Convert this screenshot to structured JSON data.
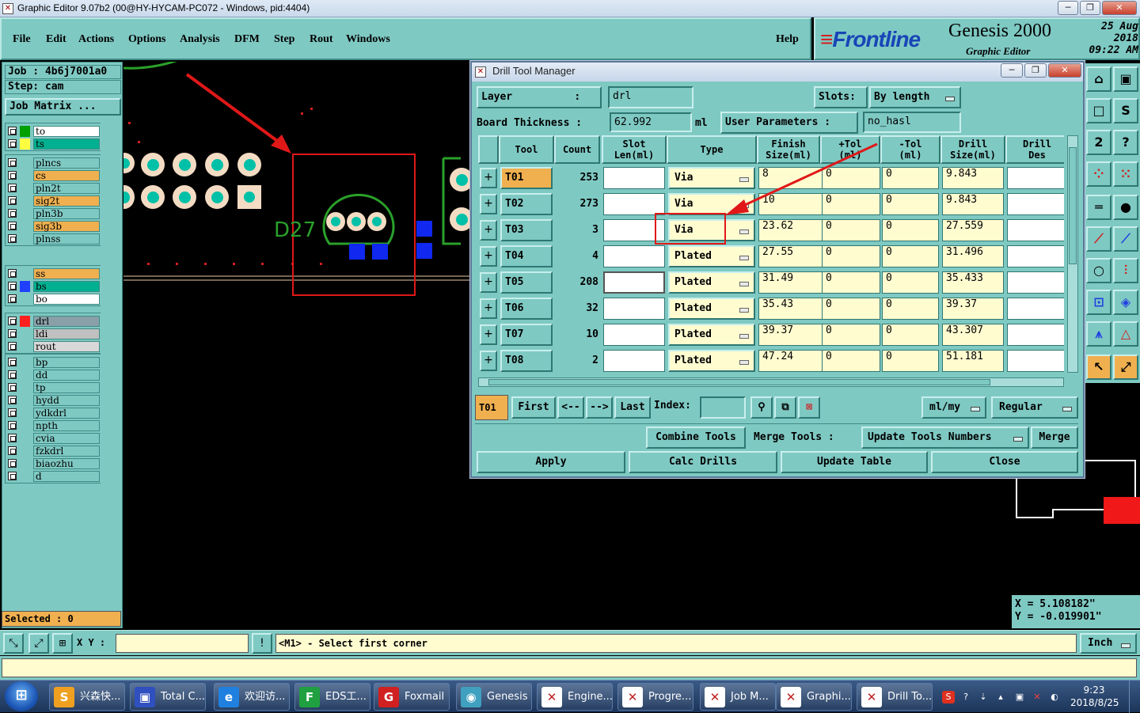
{
  "window": {
    "title": "Graphic Editor 9.07b2 (00@HY-HYCAM-PC072 - Windows, pid:4404)"
  },
  "menu": [
    "File",
    "Edit",
    "Actions",
    "Options",
    "Analysis",
    "DFM",
    "Step",
    "Rout",
    "Windows"
  ],
  "help": "Help",
  "brand": {
    "logo": "Frontline",
    "product": "Genesis 2000",
    "subtitle": "Graphic Editor",
    "date": "25 Aug 2018",
    "time": "09:22 AM"
  },
  "job": {
    "job_label": "Job : 4b6j7001a0",
    "step_label": "Step: cam",
    "matrix_button": "Job Matrix ..."
  },
  "layer_groups": [
    [
      {
        "name": "to",
        "swatch": "#00a000",
        "bg": "#ffffff"
      },
      {
        "name": "ts",
        "swatch": "#ffff40",
        "bg": "#00b090"
      }
    ],
    [
      {
        "name": "plncs",
        "swatch": "",
        "bg": "#7fc9c3"
      },
      {
        "name": "cs",
        "swatch": "",
        "bg": "#f0b050"
      },
      {
        "name": "pln2t",
        "swatch": "",
        "bg": "#7fc9c3"
      },
      {
        "name": "sig2t",
        "swatch": "",
        "bg": "#f0b050"
      },
      {
        "name": "pln3b",
        "swatch": "",
        "bg": "#7fc9c3"
      },
      {
        "name": "sig3b",
        "swatch": "",
        "bg": "#f0b050"
      },
      {
        "name": "plnss",
        "swatch": "",
        "bg": "#7fc9c3"
      }
    ],
    [
      {
        "name": "ss",
        "swatch": "",
        "bg": "#f0b050"
      },
      {
        "name": "bs",
        "swatch": "#2040ff",
        "bg": "#00b090"
      },
      {
        "name": "bo",
        "swatch": "",
        "bg": "#ffffff"
      }
    ],
    [
      {
        "name": "drl",
        "swatch": "#ff2020",
        "bg": "#8aa0a8"
      },
      {
        "name": "ldi",
        "swatch": "",
        "bg": "#c0c0c0"
      },
      {
        "name": "rout",
        "swatch": "",
        "bg": "#d8d8d8"
      }
    ],
    [
      {
        "name": "bp",
        "swatch": "",
        "bg": "#7fc9c3"
      },
      {
        "name": "dd",
        "swatch": "",
        "bg": "#7fc9c3"
      },
      {
        "name": "tp",
        "swatch": "",
        "bg": "#7fc9c3"
      },
      {
        "name": "hydd",
        "swatch": "",
        "bg": "#7fc9c3"
      },
      {
        "name": "ydkdrl",
        "swatch": "",
        "bg": "#7fc9c3"
      },
      {
        "name": "npth",
        "swatch": "",
        "bg": "#7fc9c3"
      },
      {
        "name": "cvia",
        "swatch": "",
        "bg": "#7fc9c3"
      },
      {
        "name": "fzkdrl",
        "swatch": "",
        "bg": "#7fc9c3"
      },
      {
        "name": "biaozhu",
        "swatch": "",
        "bg": "#7fc9c3"
      },
      {
        "name": "d",
        "swatch": "",
        "bg": "#7fc9c3"
      }
    ]
  ],
  "selected": "Selected : 0",
  "canvas": {
    "component_label": "D27"
  },
  "dialog": {
    "title": "Drill Tool Manager",
    "layer_label": "Layer          :",
    "layer_value": "drl",
    "slots_label": "Slots:",
    "slots_value": "By length",
    "thickness_label": "Board Thickness :",
    "thickness_value": "62.992",
    "thickness_unit": "ml",
    "user_params_label": "User Parameters :",
    "user_params_value": "no_hasl",
    "headers": [
      "Tool",
      "Count",
      "Slot\nLen(ml)",
      "Type",
      "Finish\nSize(ml)",
      "+Tol\n(ml)",
      "-Tol\n(ml)",
      "Drill\nSize(ml)",
      "Drill\nDes"
    ],
    "rows": [
      {
        "tool": "T01",
        "count": "253",
        "type": "Via",
        "finish": "8",
        "ptol": "0",
        "mtol": "0",
        "drill": "9.843"
      },
      {
        "tool": "T02",
        "count": "273",
        "type": "Via",
        "finish": "10",
        "ptol": "0",
        "mtol": "0",
        "drill": "9.843"
      },
      {
        "tool": "T03",
        "count": "3",
        "type": "Via",
        "finish": "23.62",
        "ptol": "0",
        "mtol": "0",
        "drill": "27.559"
      },
      {
        "tool": "T04",
        "count": "4",
        "type": "Plated",
        "finish": "27.55",
        "ptol": "0",
        "mtol": "0",
        "drill": "31.496"
      },
      {
        "tool": "T05",
        "count": "208",
        "type": "Plated",
        "finish": "31.49",
        "ptol": "0",
        "mtol": "0",
        "drill": "35.433"
      },
      {
        "tool": "T06",
        "count": "32",
        "type": "Plated",
        "finish": "35.43",
        "ptol": "0",
        "mtol": "0",
        "drill": "39.37"
      },
      {
        "tool": "T07",
        "count": "10",
        "type": "Plated",
        "finish": "39.37",
        "ptol": "0",
        "mtol": "0",
        "drill": "43.307"
      },
      {
        "tool": "T08",
        "count": "2",
        "type": "Plated",
        "finish": "47.24",
        "ptol": "0",
        "mtol": "0",
        "drill": "51.181"
      }
    ],
    "current_tool": "T01",
    "nav": {
      "first": "First",
      "prev": "<--",
      "next": "-->",
      "last": "Last",
      "index_label": "Index:"
    },
    "units": "ml/my",
    "mode": "Regular",
    "combine": "Combine Tools",
    "merge_label": "Merge Tools :",
    "update_numbers": "Update Tools Numbers",
    "merge": "Merge",
    "apply": "Apply",
    "calc": "Calc Drills",
    "update_table": "Update Table",
    "close": "Close"
  },
  "coords": {
    "x": "X  =  5.108182\"",
    "y": "Y  = -0.019901\""
  },
  "cmd": {
    "xy_label": "X Y :",
    "message": "<M1> - Select first corner",
    "units": "Inch"
  },
  "taskbar": {
    "items": [
      {
        "label": "兴森快...",
        "color": "#f0a020",
        "glyph": "S"
      },
      {
        "label": "Total C...",
        "color": "#3050c0",
        "glyph": "▣"
      },
      {
        "label": "欢迎访...",
        "color": "#2080e0",
        "glyph": "e"
      },
      {
        "label": "EDS工...",
        "color": "#20a040",
        "glyph": "F"
      },
      {
        "label": "Foxmail",
        "color": "#d02020",
        "glyph": "G"
      },
      {
        "label": "Genesis",
        "color": "#40a0c0",
        "glyph": "◉"
      },
      {
        "label": "Engine...",
        "color": "#ffffff",
        "glyph": "✕"
      },
      {
        "label": "Progre...",
        "color": "#ffffff",
        "glyph": "✕"
      },
      {
        "label": "Job M...",
        "color": "#ffffff",
        "glyph": "✕"
      },
      {
        "label": "Graphi...",
        "color": "#ffffff",
        "glyph": "✕"
      },
      {
        "label": "Drill To...",
        "color": "#ffffff",
        "glyph": "✕"
      }
    ],
    "time": "9:23",
    "date": "2018/8/25"
  }
}
